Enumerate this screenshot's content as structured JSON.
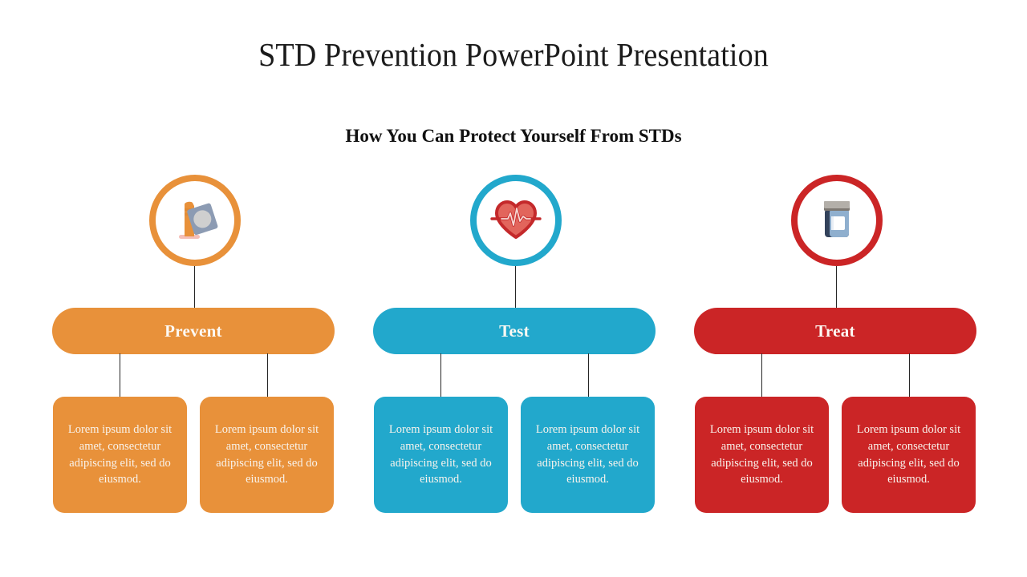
{
  "slide": {
    "title": "STD Prevention PowerPoint Presentation",
    "subtitle": "How You Can Protect Yourself From STDs",
    "background_color": "#ffffff"
  },
  "columns": [
    {
      "key": "prevent",
      "banner_label": "Prevent",
      "color": "#E8913A",
      "icon": "condom-icon",
      "cards": [
        {
          "text": "Lorem ipsum dolor sit amet, consectetur adipiscing elit, sed do eiusmod."
        },
        {
          "text": "Lorem ipsum dolor sit amet, consectetur adipiscing elit, sed do eiusmod."
        }
      ]
    },
    {
      "key": "test",
      "banner_label": "Test",
      "color": "#22A8CC",
      "icon": "heartbeat-icon",
      "cards": [
        {
          "text": "Lorem ipsum dolor sit amet, consectetur adipiscing elit, sed do eiusmod."
        },
        {
          "text": "Lorem ipsum dolor sit amet, consectetur adipiscing elit, sed do eiusmod."
        }
      ]
    },
    {
      "key": "treat",
      "banner_label": "Treat",
      "color": "#CB2526",
      "icon": "pill-bottle-icon",
      "cards": [
        {
          "text": "Lorem ipsum dolor sit amet, consectetur adipiscing elit, sed do eiusmod."
        },
        {
          "text": "Lorem ipsum dolor sit amet, consectetur adipiscing elit, sed do eiusmod."
        }
      ]
    }
  ],
  "icon_colors": {
    "condom_body": "#E8913A",
    "condom_base": "#F4BFB8",
    "wrapper": "#8C9BB3",
    "wrapper_circle": "#CFCFCF",
    "heart_fill": "#E2655C",
    "heart_stroke": "#C4292B",
    "pulse_line": "#F6D7D2",
    "bottle_body": "#8FAFCE",
    "bottle_outline": "#33425B",
    "bottle_cap": "#A8A49F",
    "bottle_label": "#FFFFFF"
  },
  "connector_color": "#262626",
  "text_color_on_color": "#F8F3EC"
}
